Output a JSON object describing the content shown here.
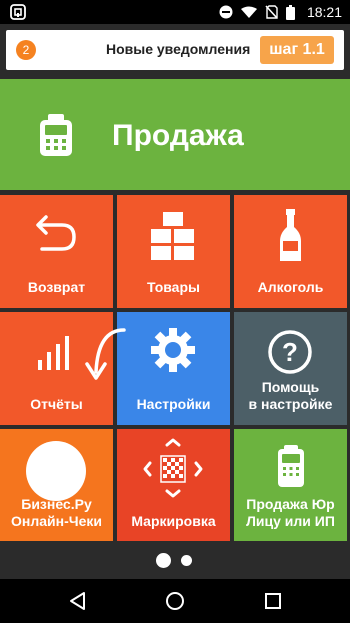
{
  "status_bar": {
    "time": "18:21",
    "icons": [
      "app-notification-icon",
      "do-not-disturb-icon",
      "wifi-icon",
      "no-sim-icon",
      "battery-icon"
    ]
  },
  "notification": {
    "count": "2",
    "text": "Новые уведомления",
    "step": "шаг 1.1"
  },
  "sale": {
    "label": "Продажа",
    "icon": "payment-terminal-icon"
  },
  "tiles": [
    {
      "label": "Возврат",
      "icon": "return-arrow-icon",
      "color": "#f2582a"
    },
    {
      "label": "Товары",
      "icon": "boxes-icon",
      "color": "#f2582a"
    },
    {
      "label": "Алкоголь",
      "icon": "bottle-icon",
      "color": "#f2582a"
    },
    {
      "label": "Отчёты",
      "icon": "bar-chart-icon",
      "color": "#f2582a"
    },
    {
      "label": "Настройки",
      "icon": "gear-icon",
      "color": "#3a86e8"
    },
    {
      "label_line1": "Помощь",
      "label_line2": "в настройке",
      "icon": "question-icon",
      "color": "#4c5f67"
    },
    {
      "label_line1": "Бизнес.Ру",
      "label_line2": "Онлайн-Чеки",
      "icon": "white-circle-logo",
      "color": "#f5751e"
    },
    {
      "label": "Маркировка",
      "icon": "datamatrix-scan-icon",
      "color": "#e84426"
    },
    {
      "label_line1": "Продажа Юр",
      "label_line2": "Лицу или ИП",
      "icon": "payment-terminal-icon",
      "color": "#6cb33f"
    }
  ],
  "pager": {
    "pages": 2,
    "current": 1
  },
  "nav": [
    "back-icon",
    "home-icon",
    "recents-icon"
  ],
  "colors": {
    "green": "#6cb33f",
    "orange": "#f2582a",
    "blue": "#3a86e8",
    "slate": "#4c5f67",
    "notif_orange": "#f58220"
  }
}
